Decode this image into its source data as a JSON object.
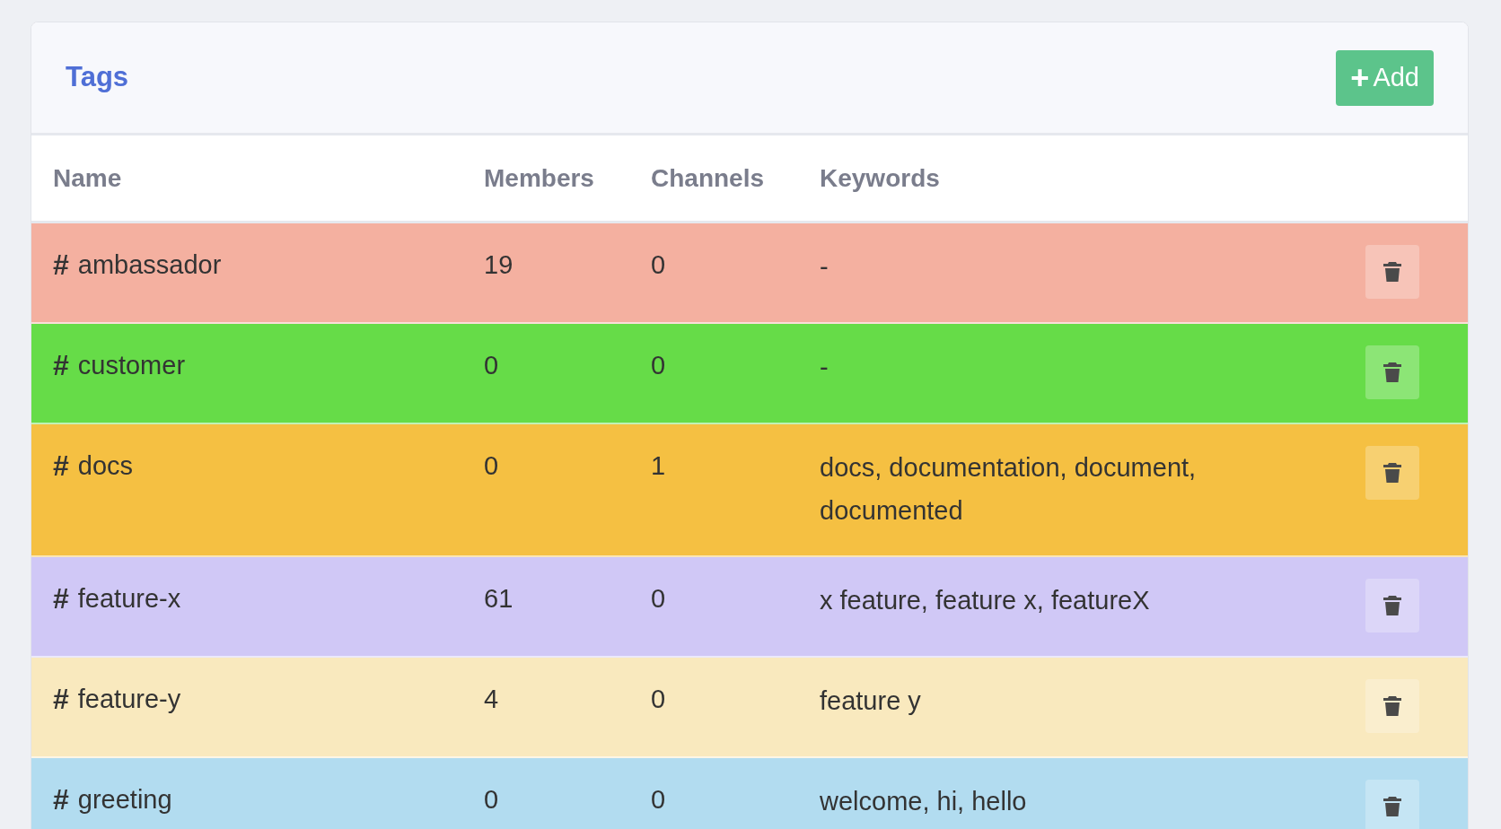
{
  "card": {
    "title": "Tags",
    "add_button": {
      "icon": "+",
      "label": "Add"
    }
  },
  "table": {
    "columns": [
      "Name",
      "Members",
      "Channels",
      "Keywords"
    ],
    "rows": [
      {
        "hash": "#",
        "name": "ambassador",
        "members": "19",
        "channels": "0",
        "keywords": "-",
        "color": "#f4b0a0"
      },
      {
        "hash": "#",
        "name": "customer",
        "members": "0",
        "channels": "0",
        "keywords": "-",
        "color": "#66dc48"
      },
      {
        "hash": "#",
        "name": "docs",
        "members": "0",
        "channels": "1",
        "keywords": "docs, documentation, document, documented",
        "color": "#f5c042"
      },
      {
        "hash": "#",
        "name": "feature-x",
        "members": "61",
        "channels": "0",
        "keywords": "x feature, feature x, featureX",
        "color": "#d0c8f6"
      },
      {
        "hash": "#",
        "name": "feature-y",
        "members": "4",
        "channels": "0",
        "keywords": "feature y",
        "color": "#f9e9be"
      },
      {
        "hash": "#",
        "name": "greeting",
        "members": "0",
        "channels": "0",
        "keywords": "welcome, hi, hello",
        "color": "#b2dcf0"
      }
    ]
  }
}
